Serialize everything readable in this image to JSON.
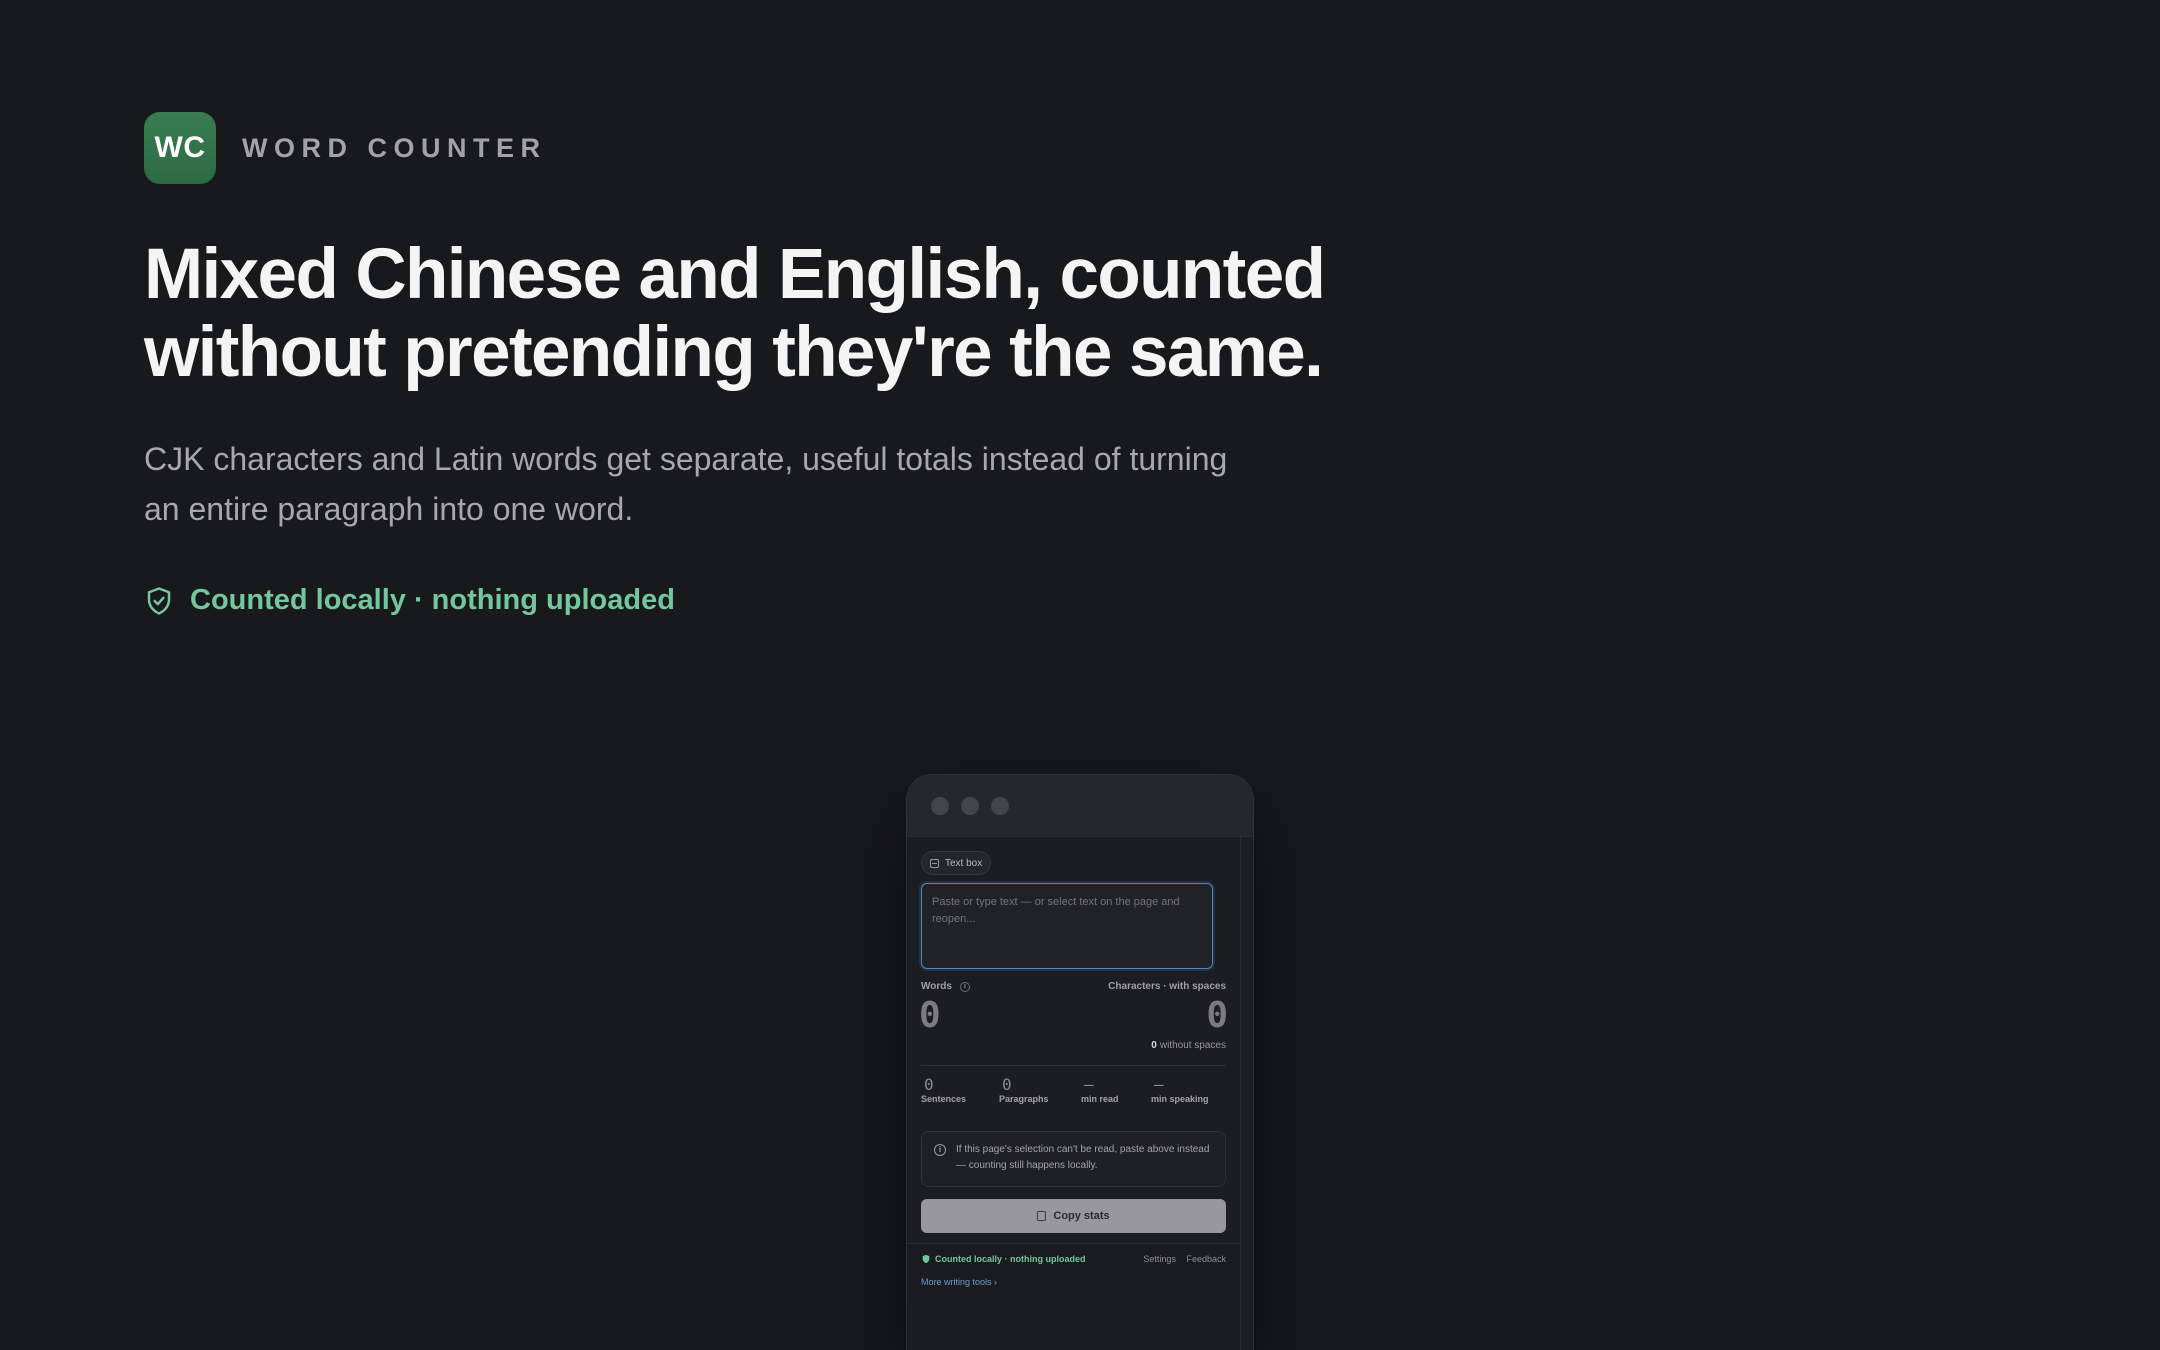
{
  "brand": {
    "logo_text": "WC",
    "name": "WORD COUNTER"
  },
  "hero": {
    "headline": "Mixed Chinese and English, counted without pretending they're the same.",
    "subline": "CJK characters and Latin words get separate, useful totals instead of turning an entire paragraph into one word.",
    "local_note": "Counted locally · nothing uploaded",
    "accent_color": "#74c69d"
  },
  "popup": {
    "source_chip": "Text box",
    "textbox": {
      "value": "",
      "placeholder": "Paste or type text — or select text on the page and reopen..."
    },
    "words": {
      "label": "Words",
      "value": "0"
    },
    "characters": {
      "label": "Characters · with spaces",
      "value": "0",
      "without_spaces_value": "0",
      "without_spaces_label": "without spaces"
    },
    "stats": [
      {
        "value": "0",
        "label": "Sentences"
      },
      {
        "value": "0",
        "label": "Paragraphs"
      },
      {
        "value": "—",
        "label": "min read"
      },
      {
        "value": "—",
        "label": "min speaking"
      }
    ],
    "hint": "If this page's selection can't be read, paste above instead — counting still happens locally.",
    "copy_button": "Copy stats",
    "footer": {
      "local": "Counted locally · nothing uploaded",
      "settings": "Settings",
      "feedback": "Feedback",
      "more_tools": "More writing tools ›"
    }
  }
}
